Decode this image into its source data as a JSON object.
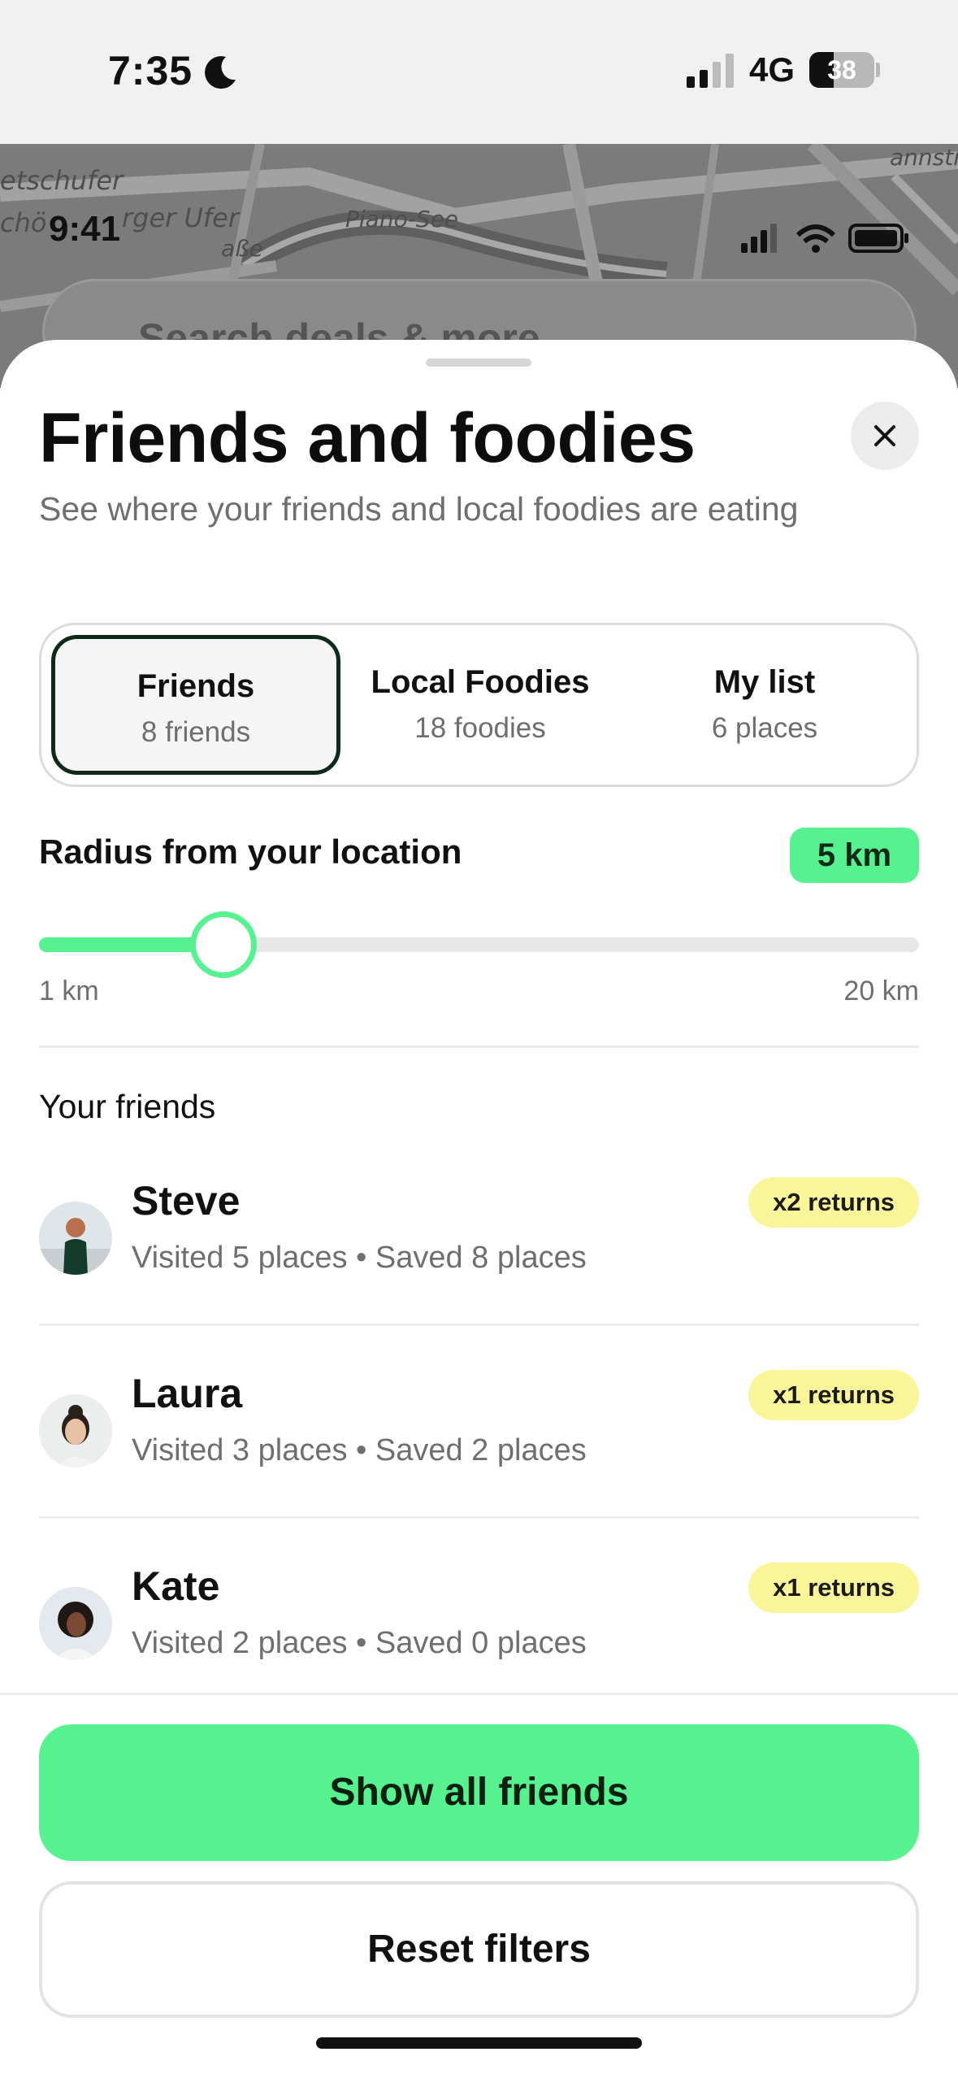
{
  "os_status": {
    "time": "7:35",
    "network": "4G",
    "battery": "38",
    "battery_level": 0.38
  },
  "map": {
    "labels": [
      "etschufer",
      "chö",
      "rger Ufer",
      "aße",
      "Piano-See",
      "annstr"
    ],
    "inner_time": "9:41",
    "search_placeholder": "Search deals & more"
  },
  "sheet": {
    "title": "Friends and foodies",
    "subtitle": "See where your friends and local foodies are eating",
    "tabs": [
      {
        "label": "Friends",
        "sub": "8 friends",
        "active": true
      },
      {
        "label": "Local Foodies",
        "sub": "18 foodies",
        "active": false
      },
      {
        "label": "My list",
        "sub": "6 places",
        "active": false
      }
    ],
    "radius": {
      "label": "Radius from your location",
      "value_label": "5 km",
      "value_fraction": 0.21,
      "min_label": "1 km",
      "max_label": "20 km"
    },
    "friends_section_title": "Your friends",
    "friends": [
      {
        "name": "Steve",
        "meta": "Visited 5 places • Saved 8 places",
        "returns": "x2 returns"
      },
      {
        "name": "Laura",
        "meta": "Visited 3 places • Saved 2 places",
        "returns": "x1 returns"
      },
      {
        "name": "Kate",
        "meta": "Visited 2 places • Saved 0 places",
        "returns": "x1 returns"
      }
    ],
    "primary_button": "Show all friends",
    "secondary_button": "Reset filters"
  },
  "colors": {
    "accent_green": "#56f28f",
    "badge_yellow": "#fbf59a",
    "active_tab_border": "#0e2a1a"
  }
}
